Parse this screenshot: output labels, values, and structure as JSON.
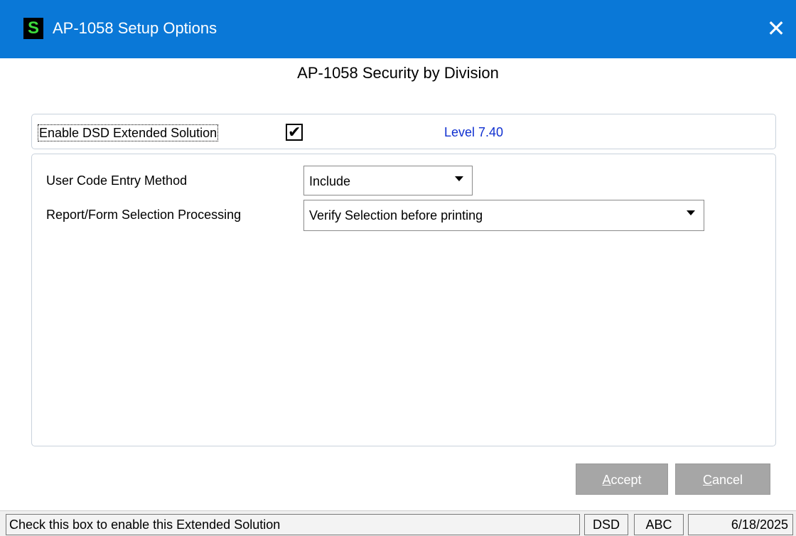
{
  "window": {
    "app_icon_letter": "S",
    "title": "AP-1058 Setup Options",
    "close_symbol": "✕",
    "accent_color": "#0a78d7"
  },
  "heading": "AP-1058 Security by Division",
  "enable_section": {
    "label": "Enable DSD Extended Solution",
    "checked": true,
    "check_symbol": "✔",
    "level_text": "Level  7.40"
  },
  "options": {
    "user_code_label": "User Code Entry Method",
    "user_code_value": "Include",
    "report_form_label": "Report/Form Selection Processing",
    "report_form_value": "Verify Selection before printing"
  },
  "buttons": {
    "accept_hotkey": "A",
    "accept_rest": "ccept",
    "cancel_hotkey": "C",
    "cancel_rest": "ancel"
  },
  "statusbar": {
    "message": "Check this box to enable this Extended Solution",
    "company_code": "DSD",
    "company": "ABC",
    "date": "6/18/2025"
  }
}
